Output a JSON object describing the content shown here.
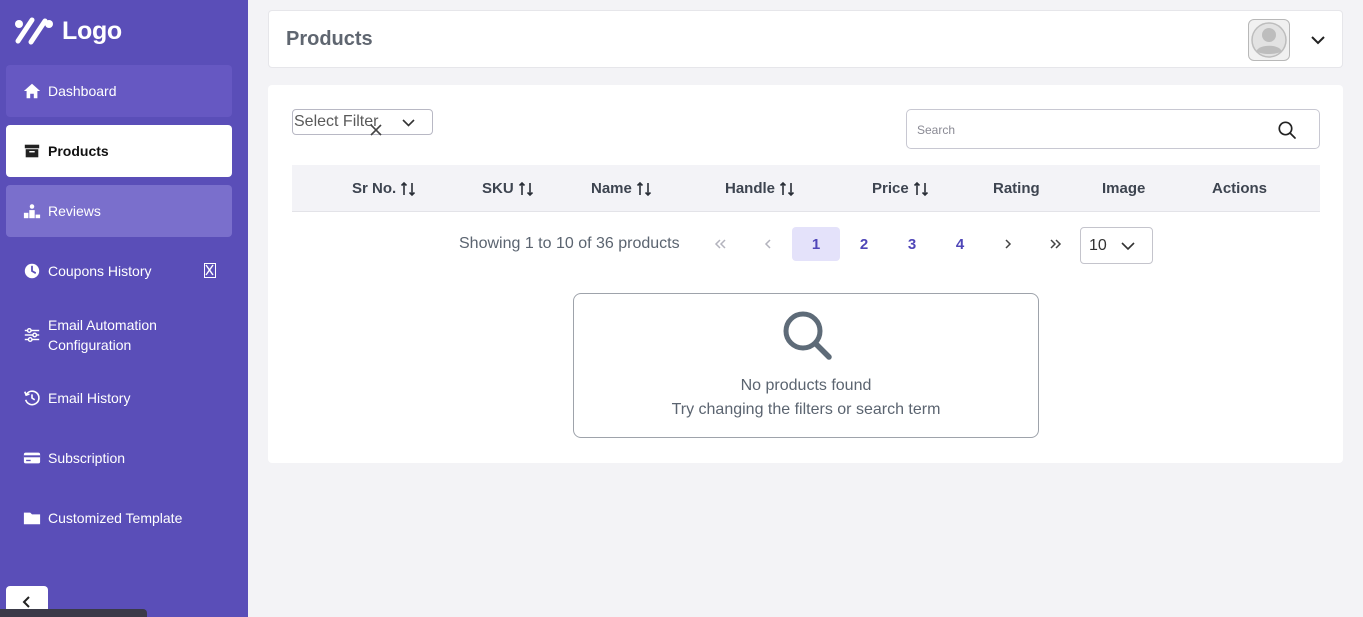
{
  "sidebar": {
    "logo_text": "Logo",
    "items": [
      {
        "label": "Dashboard",
        "icon": "home-icon"
      },
      {
        "label": "Products",
        "icon": "archive-icon"
      },
      {
        "label": "Reviews",
        "icon": "podium-icon"
      },
      {
        "label": "Coupons History",
        "icon": "clock-icon"
      },
      {
        "label": "Email Automation Configuration",
        "icon": "sliders-icon"
      },
      {
        "label": "Email History",
        "icon": "history-icon"
      },
      {
        "label": "Subscription",
        "icon": "card-icon"
      },
      {
        "label": "Customized Template",
        "icon": "folder-icon"
      }
    ],
    "active": "Products"
  },
  "header": {
    "title": "Products"
  },
  "filter": {
    "placeholder": "Select Filter"
  },
  "search": {
    "placeholder": "Search"
  },
  "table": {
    "columns": [
      "Sr No.",
      "SKU",
      "Name",
      "Handle",
      "Price",
      "Rating",
      "Image",
      "Actions"
    ]
  },
  "pagination": {
    "showing": "Showing 1 to 10 of 36 products",
    "pages": [
      "1",
      "2",
      "3",
      "4"
    ],
    "current": "1",
    "per_page": "10"
  },
  "empty_state": {
    "title": "No products found",
    "subtitle": "Try changing the filters or search term"
  },
  "colors": {
    "sidebar_bg": "#5a4eb8",
    "accent": "#4f46b8",
    "active_page_bg": "#e4e2fa"
  }
}
